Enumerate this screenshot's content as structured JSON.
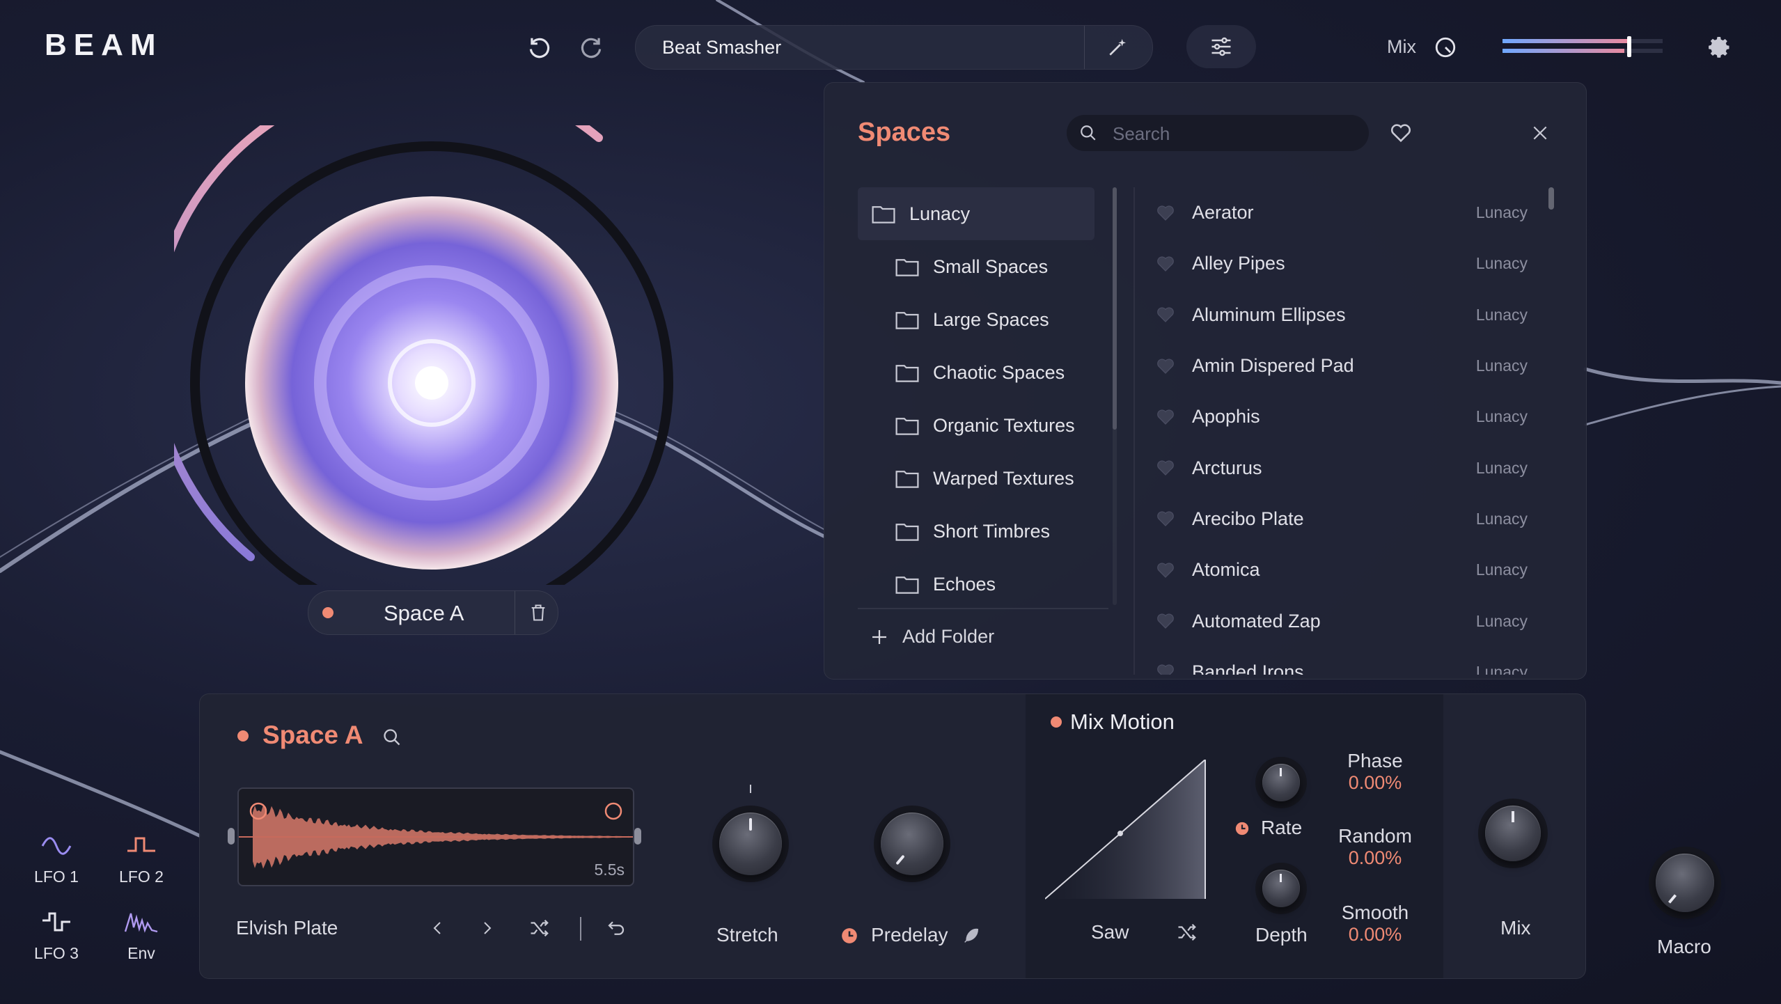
{
  "app": {
    "logo": "BEAM"
  },
  "header": {
    "preset_name": "Beat Smasher",
    "mix_label": "Mix",
    "mix_level": 0.78,
    "icons": [
      "undo-icon",
      "redo-icon",
      "magic-wand-icon",
      "sliders-icon",
      "dial-icon",
      "gear-icon"
    ]
  },
  "spaces_panel": {
    "title": "Spaces",
    "search_placeholder": "Search",
    "folders": [
      {
        "label": "Lunacy",
        "selected": true
      },
      {
        "label": "Small Spaces"
      },
      {
        "label": "Large Spaces"
      },
      {
        "label": "Chaotic Spaces"
      },
      {
        "label": "Organic Textures"
      },
      {
        "label": "Warped Textures"
      },
      {
        "label": "Short Timbres"
      },
      {
        "label": "Echoes"
      }
    ],
    "add_folder": "Add Folder",
    "presets": [
      {
        "name": "Aerator",
        "tag": "Lunacy"
      },
      {
        "name": "Alley Pipes",
        "tag": "Lunacy"
      },
      {
        "name": "Aluminum Ellipses",
        "tag": "Lunacy"
      },
      {
        "name": "Amin Dispered Pad",
        "tag": "Lunacy"
      },
      {
        "name": "Apophis",
        "tag": "Lunacy"
      },
      {
        "name": "Arcturus",
        "tag": "Lunacy"
      },
      {
        "name": "Arecibo Plate",
        "tag": "Lunacy"
      },
      {
        "name": "Atomica",
        "tag": "Lunacy"
      },
      {
        "name": "Automated Zap",
        "tag": "Lunacy"
      },
      {
        "name": "Banded Irons",
        "tag": "Lunacy"
      }
    ]
  },
  "orb": {
    "space_label": "Space A",
    "accent": "#f08a74"
  },
  "modulators": {
    "lfo1": "LFO 1",
    "lfo2": "LFO 2",
    "lfo3": "LFO 3",
    "env": "Env"
  },
  "space_section": {
    "title": "Space A",
    "ir_length": "5.5s",
    "ir_name": "Elvish Plate",
    "stretch_label": "Stretch",
    "predelay_label": "Predelay"
  },
  "mix_motion": {
    "title": "Mix Motion",
    "shape_label": "Saw",
    "rate_label": "Rate",
    "depth_label": "Depth",
    "phase_label": "Phase",
    "phase_value": "0.00%",
    "random_label": "Random",
    "random_value": "0.00%",
    "smooth_label": "Smooth",
    "smooth_value": "0.00%",
    "mix_label": "Mix"
  },
  "macro": {
    "label": "Macro"
  }
}
